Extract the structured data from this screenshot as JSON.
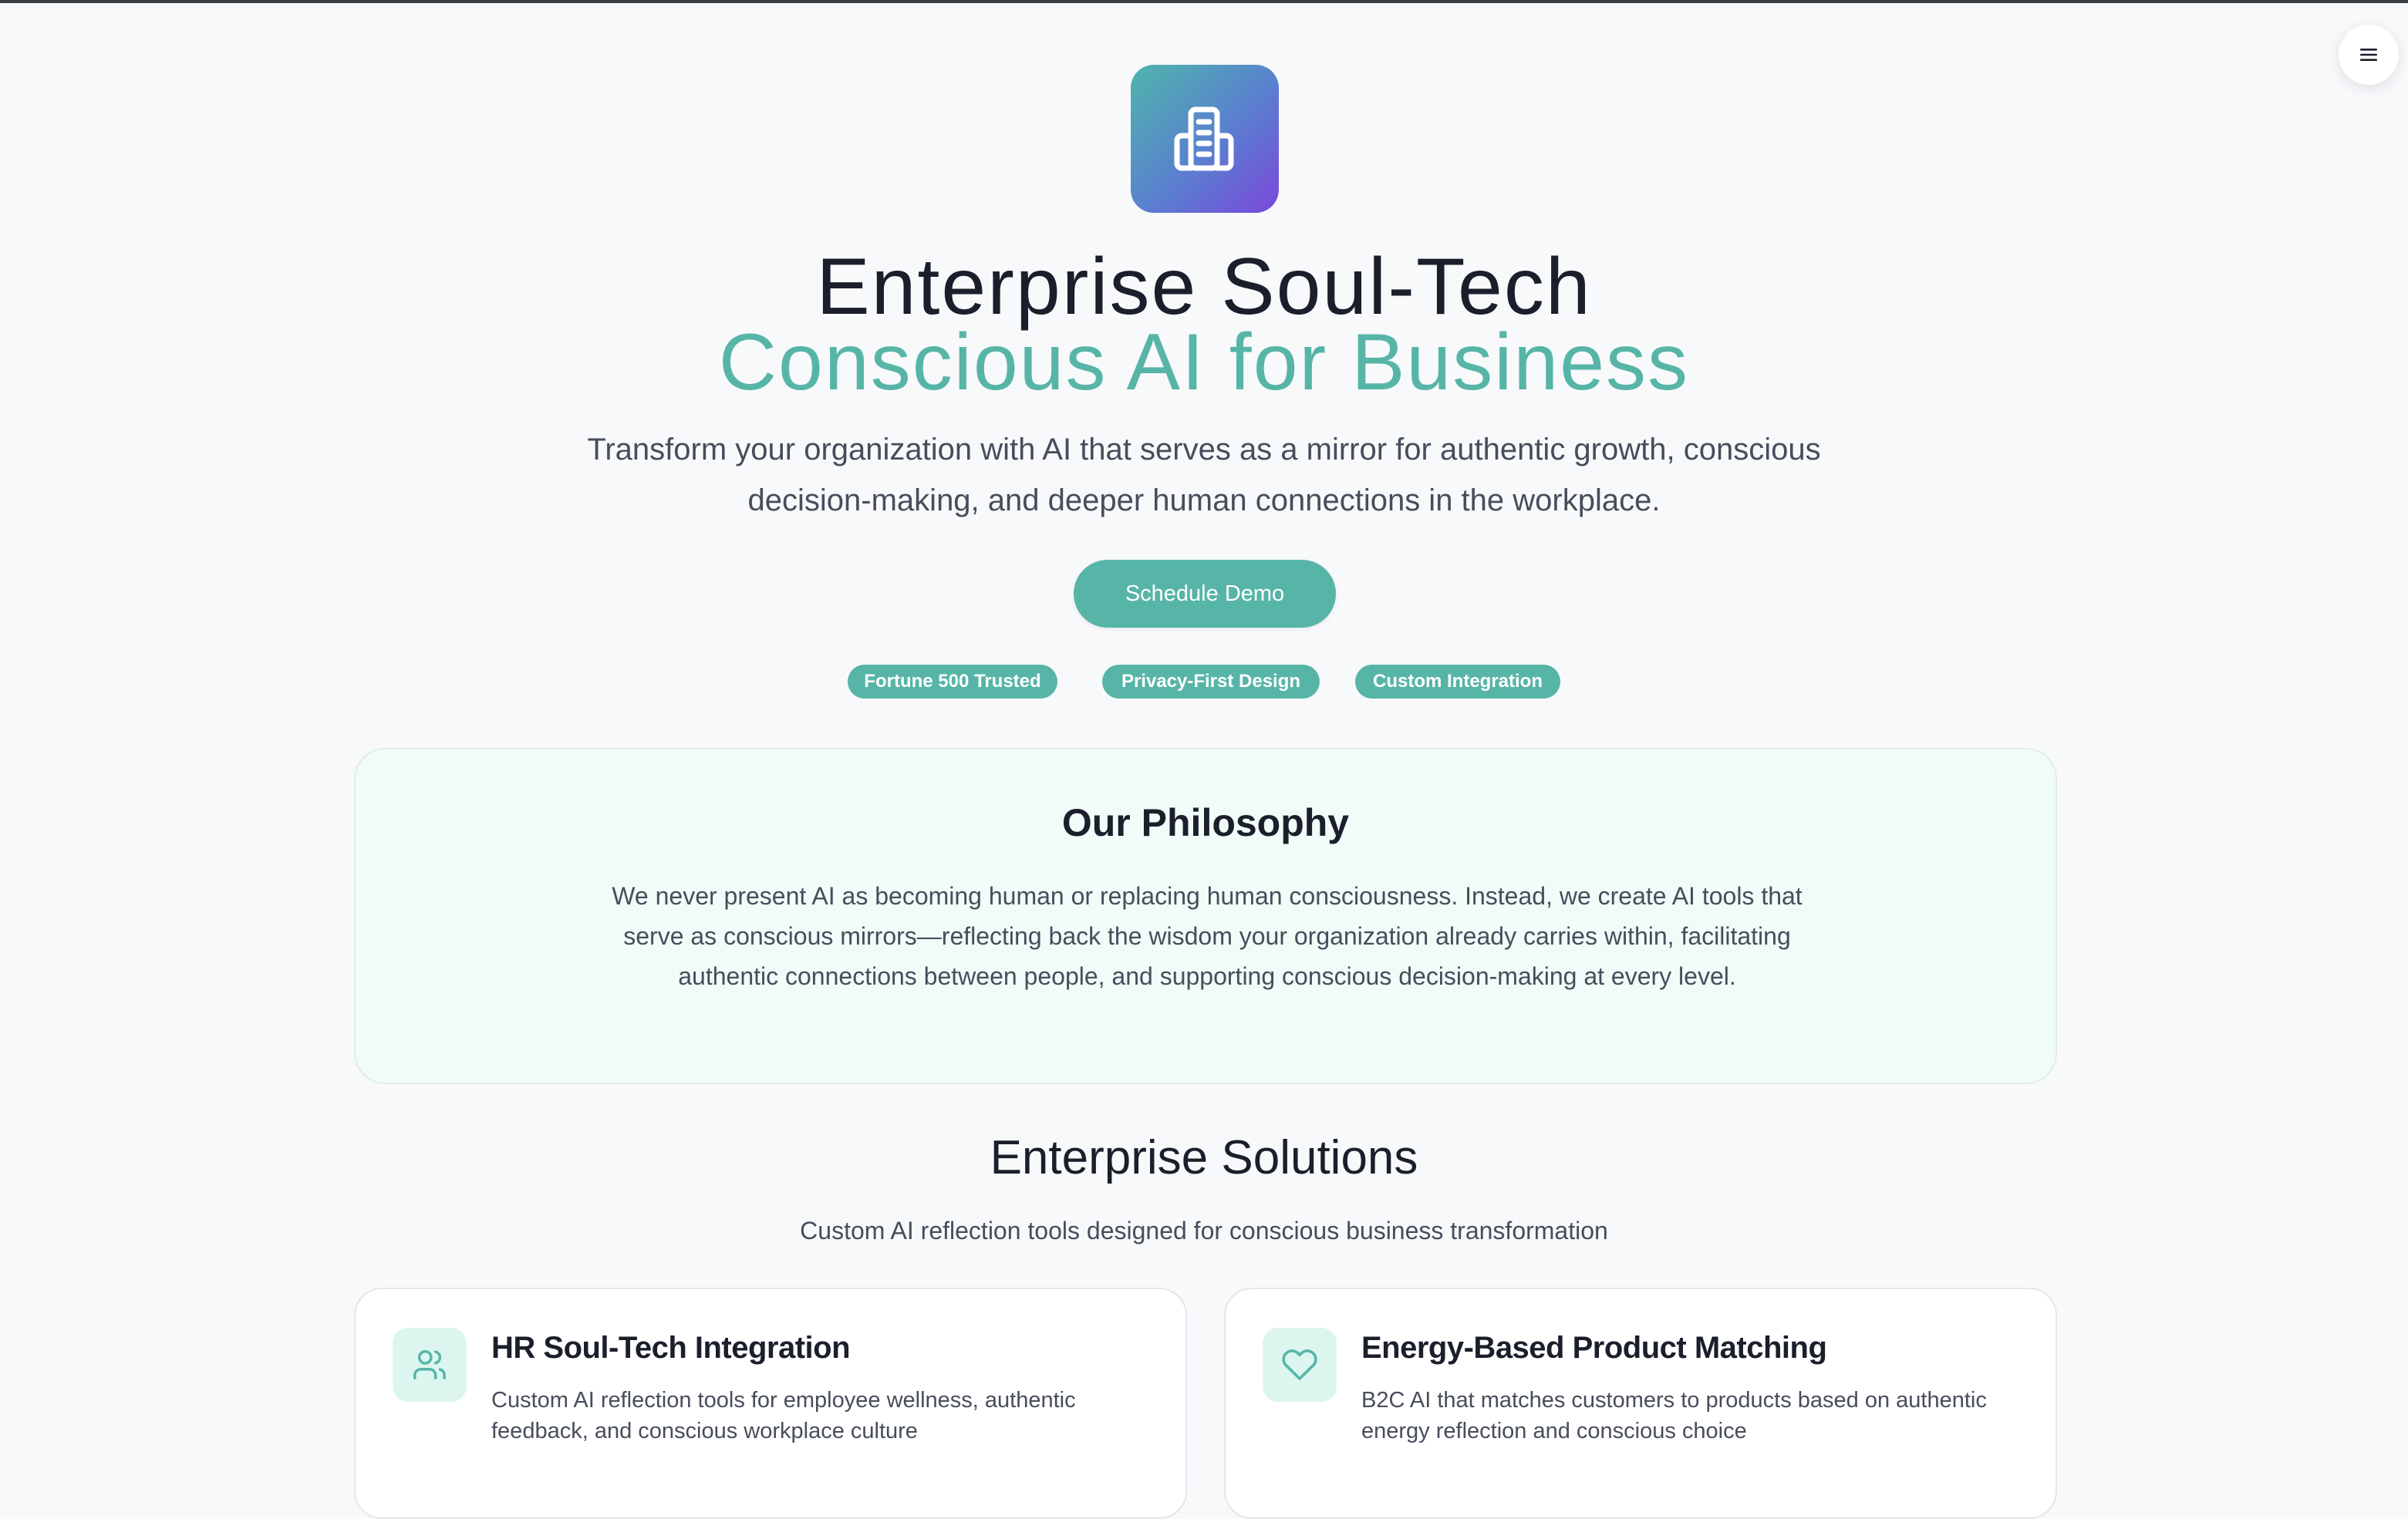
{
  "hero": {
    "logo_icon": "building-icon",
    "title_line1": "Enterprise Soul-Tech",
    "title_line2": "Conscious AI for Business",
    "subtitle": "Transform your organization with AI that serves as a mirror for authentic growth, conscious decision-making, and deeper human connections in the workplace.",
    "cta_label": "Schedule Demo",
    "badges": [
      "Fortune 500 Trusted",
      "Privacy-First Design",
      "Custom Integration"
    ]
  },
  "menu": {
    "icon": "hamburger-menu-icon"
  },
  "philosophy": {
    "heading": "Our Philosophy",
    "body": "We never present AI as becoming human or replacing human consciousness. Instead, we create AI tools that serve as conscious mirrors—reflecting back the wisdom your organization already carries within, facilitating authentic connections between people, and supporting conscious decision-making at every level."
  },
  "solutions": {
    "heading": "Enterprise Solutions",
    "subheading": "Custom AI reflection tools designed for conscious business transformation",
    "cards": [
      {
        "icon": "users-icon",
        "title": "HR Soul-Tech Integration",
        "description": "Custom AI reflection tools for employee wellness, authentic feedback, and conscious workplace culture"
      },
      {
        "icon": "heart-icon",
        "title": "Energy-Based Product Matching",
        "description": "B2C AI that matches customers to products based on authentic energy reflection and conscious choice"
      }
    ]
  },
  "colors": {
    "accent": "#57b5a7",
    "logo_gradient_start": "#4fb6ab",
    "logo_gradient_end": "#7b47db",
    "page_bg": "#f8f9fb",
    "philosophy_bg": "#f1fbf8"
  }
}
